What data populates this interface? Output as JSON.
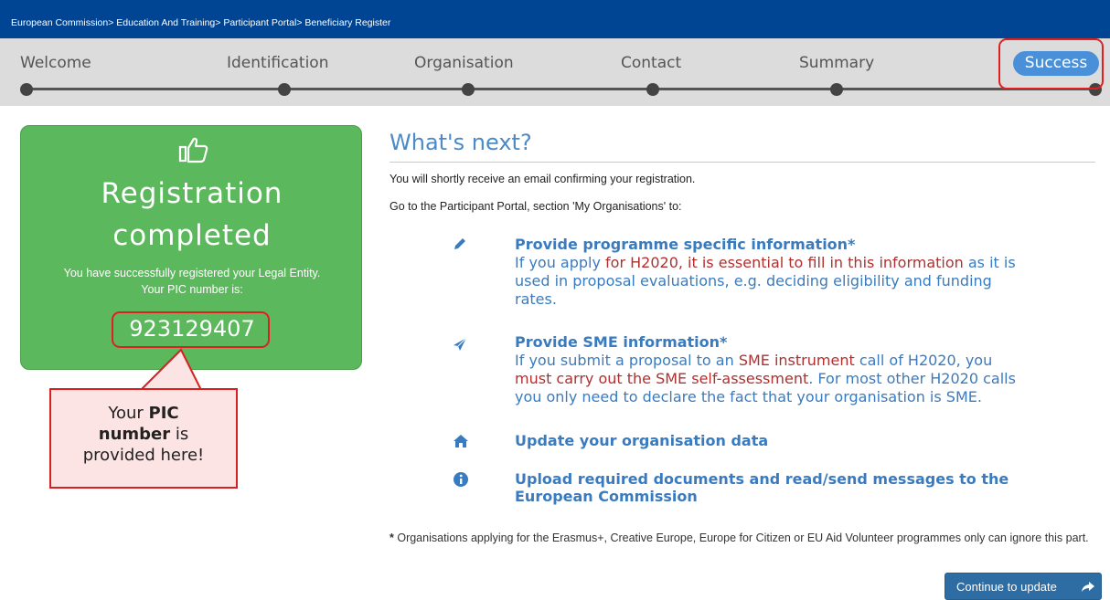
{
  "breadcrumb": {
    "items": [
      "European Commission",
      "Education And Training",
      "Participant Portal",
      "Beneficiary Register"
    ],
    "separator": "> "
  },
  "steps": {
    "items": [
      {
        "label": "Welcome"
      },
      {
        "label": "Identification"
      },
      {
        "label": "Organisation"
      },
      {
        "label": "Contact"
      },
      {
        "label": "Summary"
      },
      {
        "label": "Success"
      }
    ],
    "current": "Success"
  },
  "success_card": {
    "icon": "thumbs-up-icon",
    "title_line1": "Registration",
    "title_line2": "completed",
    "message_line1": "You have successfully registered your Legal Entity.",
    "message_line2": "Your PIC number is:",
    "pic_number": "923129407"
  },
  "callout": {
    "part1": "Your ",
    "bold1": "PIC",
    "bold2": "number",
    "part2": " is",
    "part3": "provided here!"
  },
  "next": {
    "title": "What's next?",
    "intro1": "You will shortly receive an email confirming your registration.",
    "intro2": "Go to the Participant Portal, section 'My Organisations' to:",
    "items": [
      {
        "icon": "pencil-icon",
        "heading": "Provide programme specific information*",
        "b1": "If you apply ",
        "r1": "for H2020, it is essential to fill in this information",
        "b2": " as it is",
        "line2": "used in proposal evaluations, e.g. deciding eligibility and funding",
        "line3": "rates."
      },
      {
        "icon": "paper-plane-icon",
        "heading": "Provide SME information*",
        "b1": "If you submit a proposal to an ",
        "r1": "SME instrument",
        "b2": " call of H2020, you",
        "r2": "must carry out the SME self-assessment",
        "b3": ". For most other H2020 calls",
        "line3": "you only need to declare the fact that your organisation is SME."
      },
      {
        "icon": "home-icon",
        "heading": "Update your organisation data"
      },
      {
        "icon": "info-circle-icon",
        "heading_line1": "Upload required documents and read/send messages to the",
        "heading_line2": "European Commission"
      }
    ]
  },
  "footnote": {
    "star": "*",
    "text": " Organisations applying for the Erasmus+, Creative Europe, Europe for Citizen or EU Aid Volunteer programmes only can ignore this part."
  },
  "continue_button": {
    "label": "Continue to update",
    "icon": "share-arrow-icon"
  },
  "colors": {
    "topbar": "#004494",
    "success_green": "#5cb85c",
    "accent_blue": "#3a7bbf",
    "highlight_red": "#e02020",
    "text_red": "#b03030"
  }
}
